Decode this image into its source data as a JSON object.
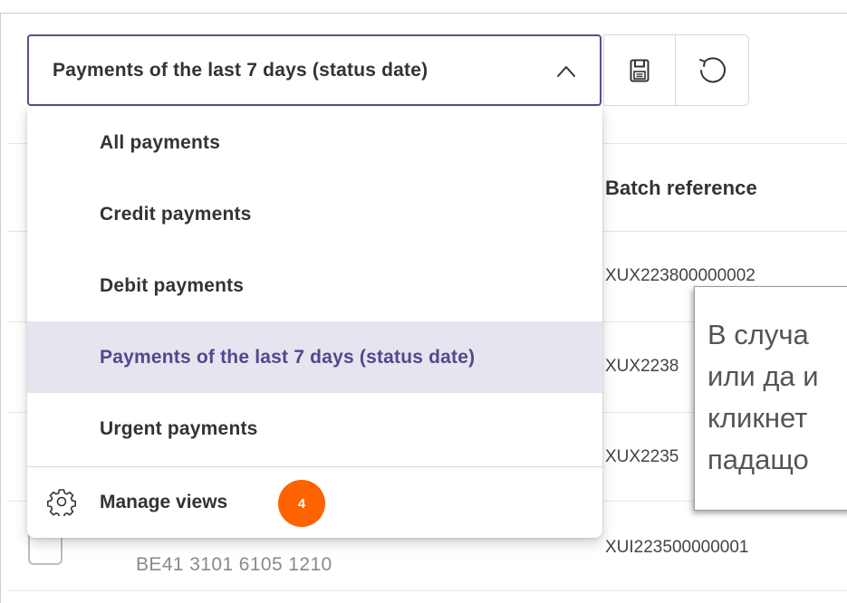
{
  "toolbar": {
    "view_selected": "Payments of the last 7 days (status date)",
    "save_icon": "floppy-disk-icon",
    "reset_icon": "undo-icon"
  },
  "dropdown": {
    "items": [
      "All payments",
      "Credit payments",
      "Debit payments",
      "Payments of the last 7 days (status date)",
      "Urgent payments"
    ],
    "selected_index": 3,
    "manage_label": "Manage views",
    "badge": "4"
  },
  "table": {
    "column_header": "Batch reference",
    "rows": [
      "XUX223800000002",
      "XUX2238",
      "XUX2235",
      "XUI223500000001"
    ],
    "iban": "BE41 3101 6105 1210"
  },
  "tooltip": {
    "lines": [
      "В случа",
      "или да и",
      "кликнет",
      "падащо"
    ]
  },
  "colors": {
    "accent": "#52478f",
    "selected_bg": "#e7e4ef",
    "badge": "#ff6200"
  }
}
